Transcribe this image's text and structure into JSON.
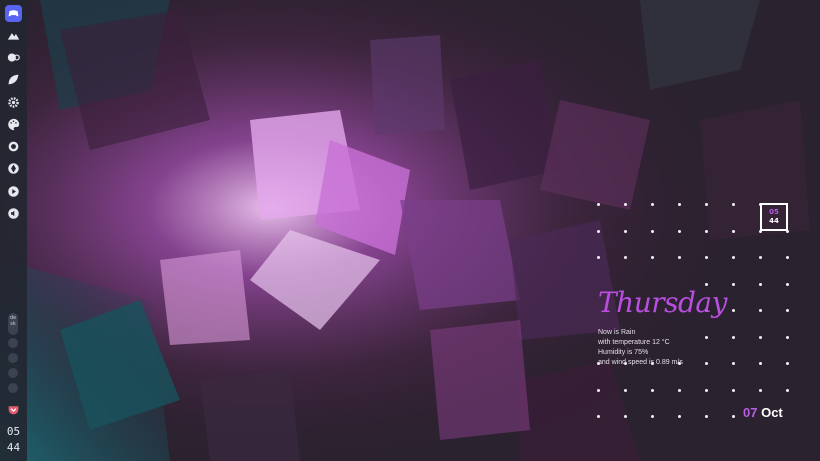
{
  "sidebar": {
    "icons": [
      {
        "name": "gamepad-icon",
        "color": "#e6e8f0"
      },
      {
        "name": "mountain-icon",
        "color": "#e6e8f0"
      },
      {
        "name": "toggle-icon",
        "color": "#e6e8f0"
      },
      {
        "name": "leaf-icon",
        "color": "#e6e8f0"
      },
      {
        "name": "gear-icon",
        "color": "#e6e8f0"
      },
      {
        "name": "palette-icon",
        "color": "#e6e8f0"
      },
      {
        "name": "refresh-icon",
        "color": "#e6e8f0"
      },
      {
        "name": "aperture-icon",
        "color": "#e6e8f0"
      },
      {
        "name": "play-icon",
        "color": "#e6e8f0"
      },
      {
        "name": "volume-icon",
        "color": "#e6e8f0"
      }
    ],
    "workspace_label_top": "de",
    "workspace_label_bottom": "sk",
    "tray_icon": "pocket-icon",
    "clock_hour": "05",
    "clock_minute": "44"
  },
  "widget": {
    "clock_hour": "05",
    "clock_minute": "44",
    "day": "Thursday",
    "weather_lines": [
      "Now is Rain",
      "with temperature 12 °C",
      "Humidity is 75%",
      "and wind speed is 0.89 m/s"
    ],
    "date_day": "07",
    "date_month": "Oct"
  },
  "colors": {
    "sidebar_bg": "#222630",
    "accent_purple": "#b94ee0",
    "date_day_color": "#b65ee6",
    "hour_color": "#b65ee6",
    "minute_color": "#ffffff",
    "text": "#ffffff"
  }
}
